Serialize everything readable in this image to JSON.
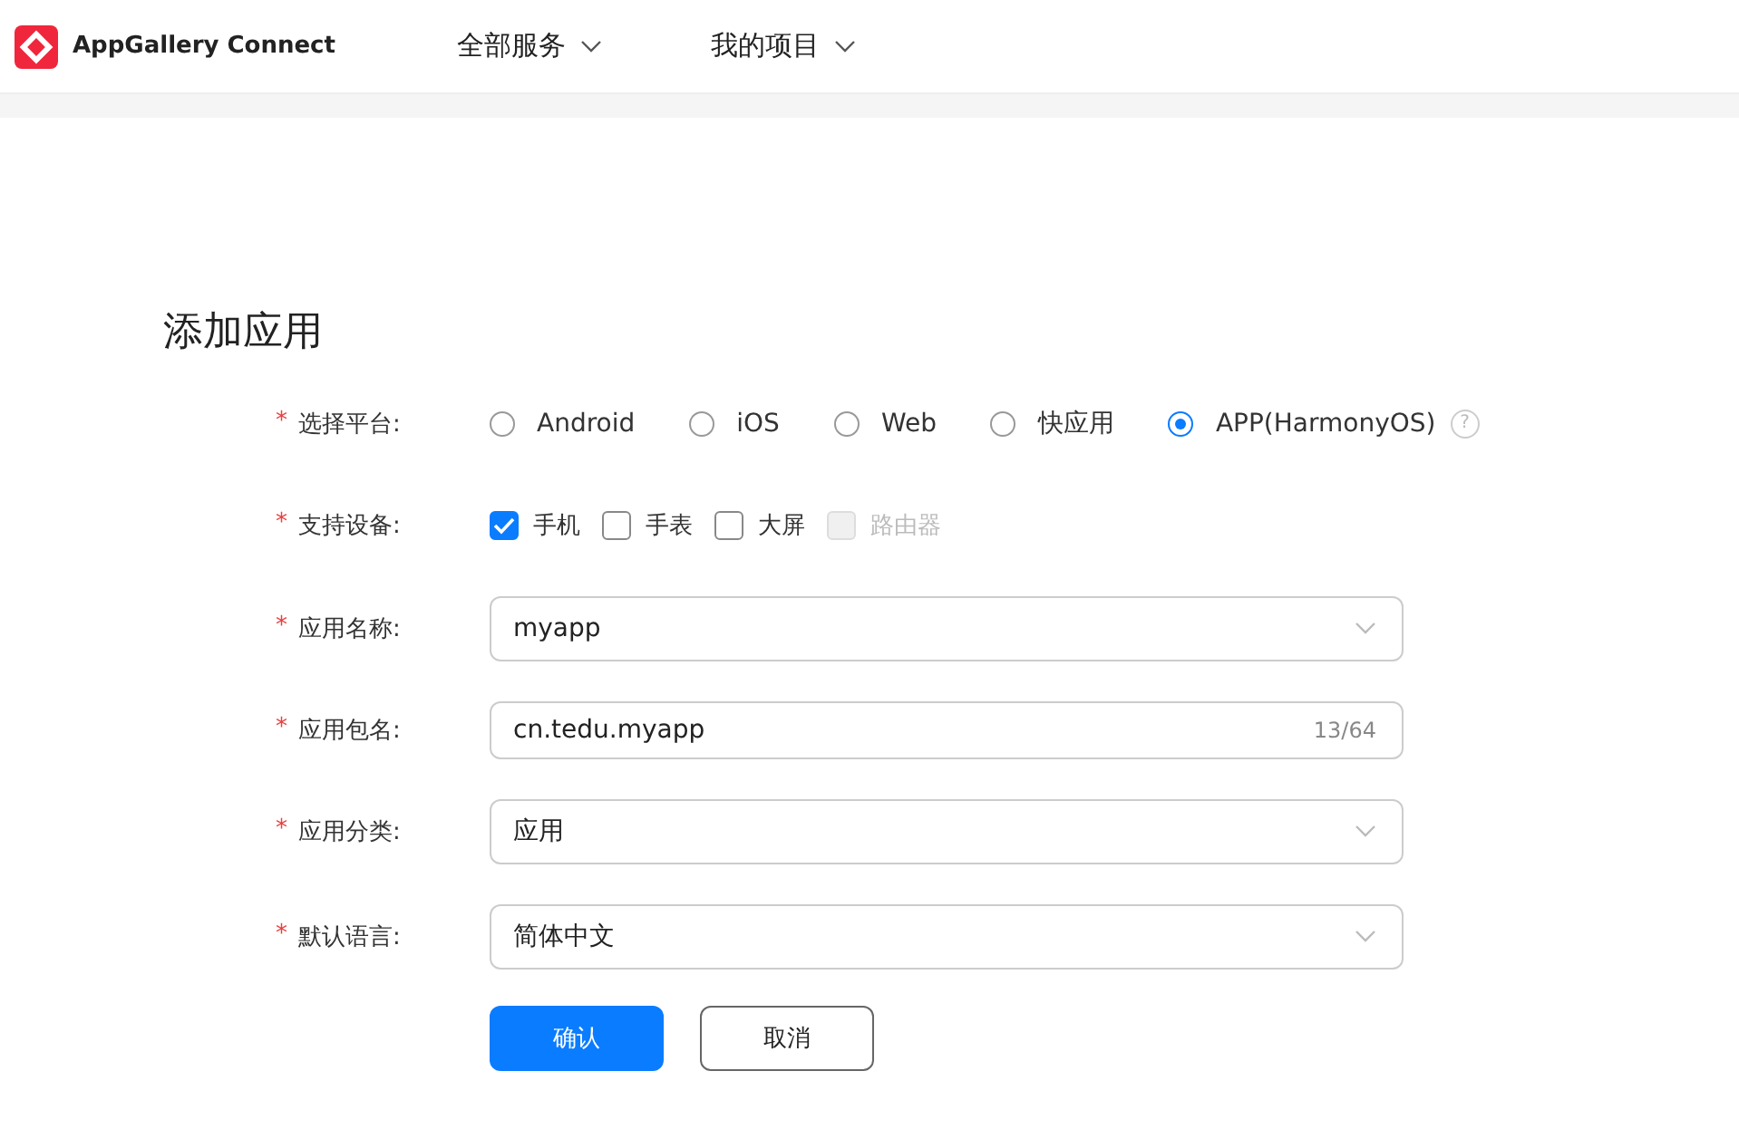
{
  "header": {
    "brand": "AppGallery Connect",
    "nav": [
      {
        "label": "全部服务"
      },
      {
        "label": "我的项目"
      }
    ]
  },
  "page_title": "添加应用",
  "platform": {
    "required_mark": "*",
    "label": "选择平台:",
    "options": [
      {
        "label": "Android",
        "selected": false
      },
      {
        "label": "iOS",
        "selected": false
      },
      {
        "label": "Web",
        "selected": false
      },
      {
        "label": "快应用",
        "selected": false
      },
      {
        "label": "APP(HarmonyOS)",
        "selected": true,
        "help": "?"
      }
    ]
  },
  "devices": {
    "required_mark": "*",
    "label": "支持设备:",
    "options": [
      {
        "label": "手机",
        "checked": true,
        "disabled": false
      },
      {
        "label": "手表",
        "checked": false,
        "disabled": false
      },
      {
        "label": "大屏",
        "checked": false,
        "disabled": false
      },
      {
        "label": "路由器",
        "checked": false,
        "disabled": true
      }
    ]
  },
  "fields": [
    {
      "kind": "select",
      "required_mark": "*",
      "label": "应用名称:",
      "value": "myapp"
    },
    {
      "kind": "text",
      "required_mark": "*",
      "label": "应用包名:",
      "value": "cn.tedu.myapp",
      "counter": "13/64"
    },
    {
      "kind": "select",
      "required_mark": "*",
      "label": "应用分类:",
      "value": "应用"
    },
    {
      "kind": "select",
      "required_mark": "*",
      "label": "默认语言:",
      "value": "简体中文"
    }
  ],
  "buttons": [
    {
      "label": "确认",
      "kind": "primary"
    },
    {
      "label": "取消",
      "kind": "secondary"
    }
  ]
}
